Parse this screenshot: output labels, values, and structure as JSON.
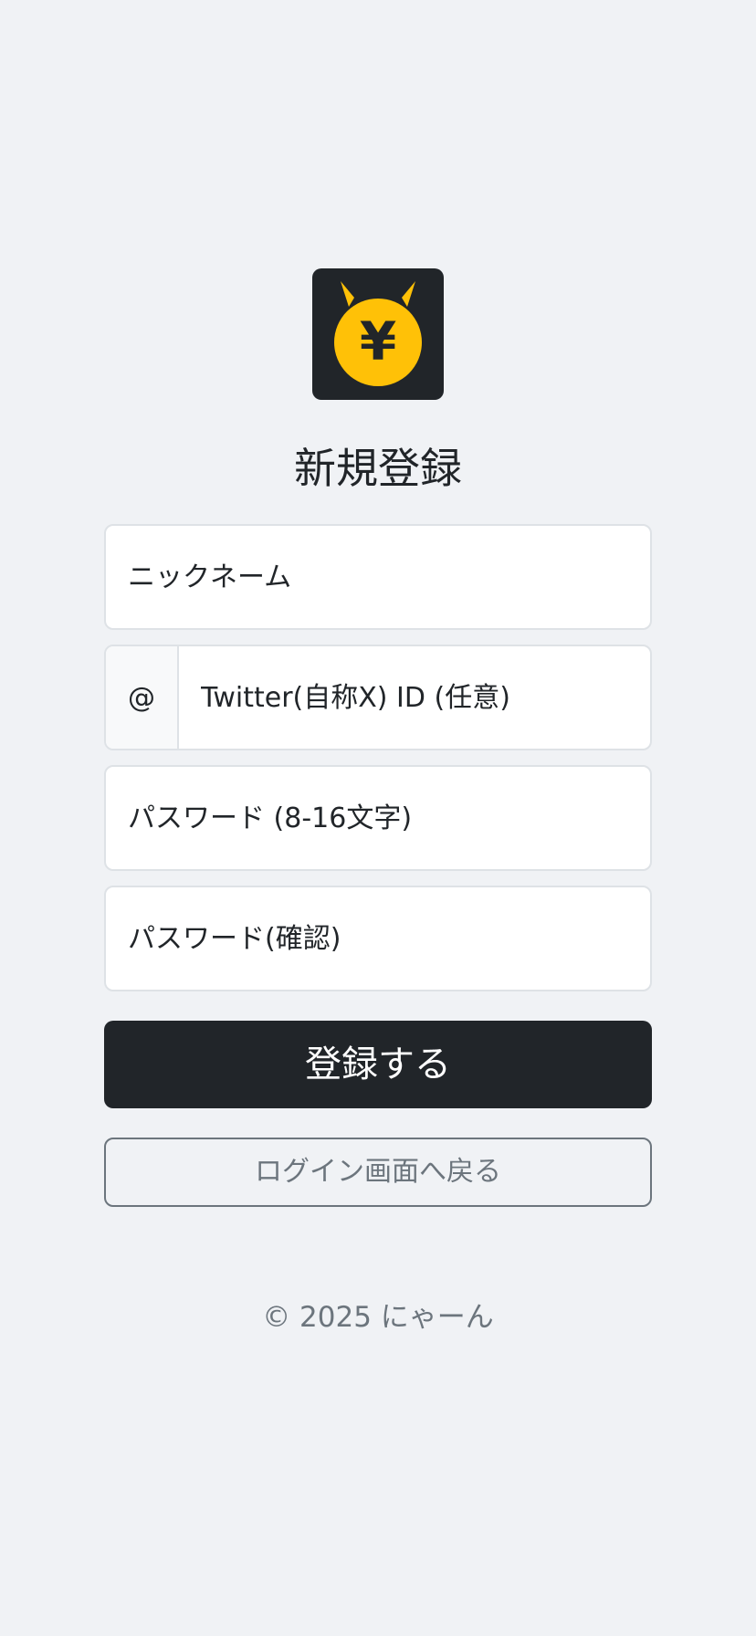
{
  "title": "新規登録",
  "logo": {
    "icon": "yen-cat-coin-icon",
    "symbol": "¥",
    "colors": {
      "background": "#212529",
      "coin": "#ffc107",
      "symbol": "#212529"
    }
  },
  "form": {
    "nickname": {
      "placeholder": "ニックネーム",
      "value": ""
    },
    "twitter": {
      "prefix": "@",
      "placeholder": "Twitter(自称X) ID (任意)",
      "value": ""
    },
    "password": {
      "placeholder": "パスワード (8-16文字)",
      "value": ""
    },
    "password_confirm": {
      "placeholder": "パスワード(確認)",
      "value": ""
    }
  },
  "buttons": {
    "register": "登録する",
    "back_to_login": "ログイン画面へ戻る"
  },
  "footer": {
    "copyright": "© 2025 にゃーん"
  },
  "colors": {
    "background": "#f0f2f5",
    "primary": "#212529",
    "muted": "#6c757d",
    "border": "#dee2e6",
    "accent": "#ffc107"
  }
}
